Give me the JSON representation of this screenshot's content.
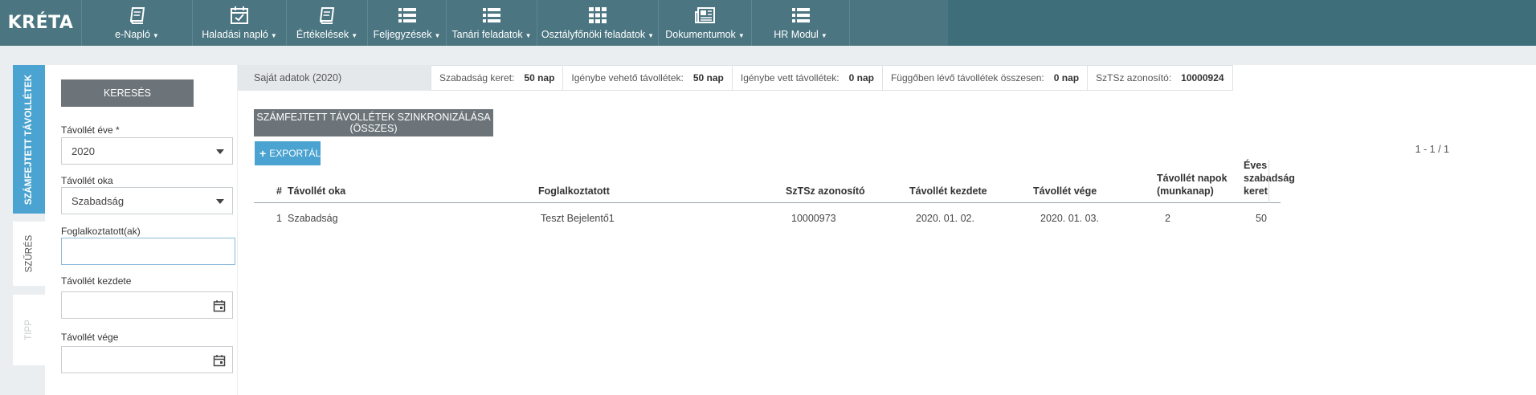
{
  "app": {
    "logo_text": "KRÉTA"
  },
  "nav": [
    {
      "label": "e-Napló",
      "icon": "notebook-icon"
    },
    {
      "label": "Haladási napló",
      "icon": "calendar-check-icon"
    },
    {
      "label": "Értékelések",
      "icon": "notebook-icon"
    },
    {
      "label": "Feljegyzések",
      "icon": "list-icon"
    },
    {
      "label": "Tanári feladatok",
      "icon": "list-icon"
    },
    {
      "label": "Osztályfőnöki feladatok",
      "icon": "grid-icon"
    },
    {
      "label": "Dokumentumok",
      "icon": "newspaper-icon"
    },
    {
      "label": "HR Modul",
      "icon": "list-icon"
    }
  ],
  "side_tabs": {
    "active": "SZÁMFEJTETT TÁVOLLÉTEK",
    "filter": "SZŰRÉS",
    "tip": "TIPP"
  },
  "filter": {
    "search_button": "KERESÉS",
    "year_label": "Távollét éve *",
    "year_value": "2020",
    "reason_label": "Távollét oka",
    "reason_value": "Szabadság",
    "employee_label": "Foglalkoztatott(ak)",
    "employee_value": "",
    "start_label": "Távollét kezdete",
    "start_value": "",
    "end_label": "Távollét vége",
    "end_value": ""
  },
  "info": {
    "own_data": "Saját adatok (2020)",
    "items": [
      {
        "label": "Szabadság keret:",
        "value": "50 nap"
      },
      {
        "label": "Igénybe vehető távollétek:",
        "value": "50 nap"
      },
      {
        "label": "Igénybe vett távollétek:",
        "value": "0 nap"
      },
      {
        "label": "Függőben lévő távollétek összesen:",
        "value": "0 nap"
      },
      {
        "label": "SzTSz azonosító:",
        "value": "10000924"
      }
    ]
  },
  "actions": {
    "sync_button": "SZÁMFEJTETT TÁVOLLÉTEK SZINKRONIZÁLÁSA (ÖSSZES)",
    "export_button": "EXPORTÁLÁS"
  },
  "pager": "1 - 1 / 1",
  "table": {
    "headers": {
      "num": "#",
      "reason": "Távollét oka",
      "employee": "Foglalkoztatott",
      "sztsz": "SzTSz azonosító",
      "start": "Távollét kezdete",
      "end": "Távollét vége",
      "days_line1": "Távollét napok",
      "days_line2": "(munkanap)",
      "annual": "Éves szabadság keret"
    },
    "rows": [
      {
        "num": "1",
        "reason": "Szabadság",
        "employee": "Teszt Bejelentő1",
        "sztsz": "10000973",
        "start": "2020. 01. 02.",
        "end": "2020. 01. 03.",
        "days": "2",
        "annual": "50"
      }
    ]
  },
  "colors": {
    "topbar": "#3f6e7b",
    "nav_panel": "#4a7581",
    "accent_blue": "#4aa3d0",
    "button_gray": "#6c7479"
  }
}
